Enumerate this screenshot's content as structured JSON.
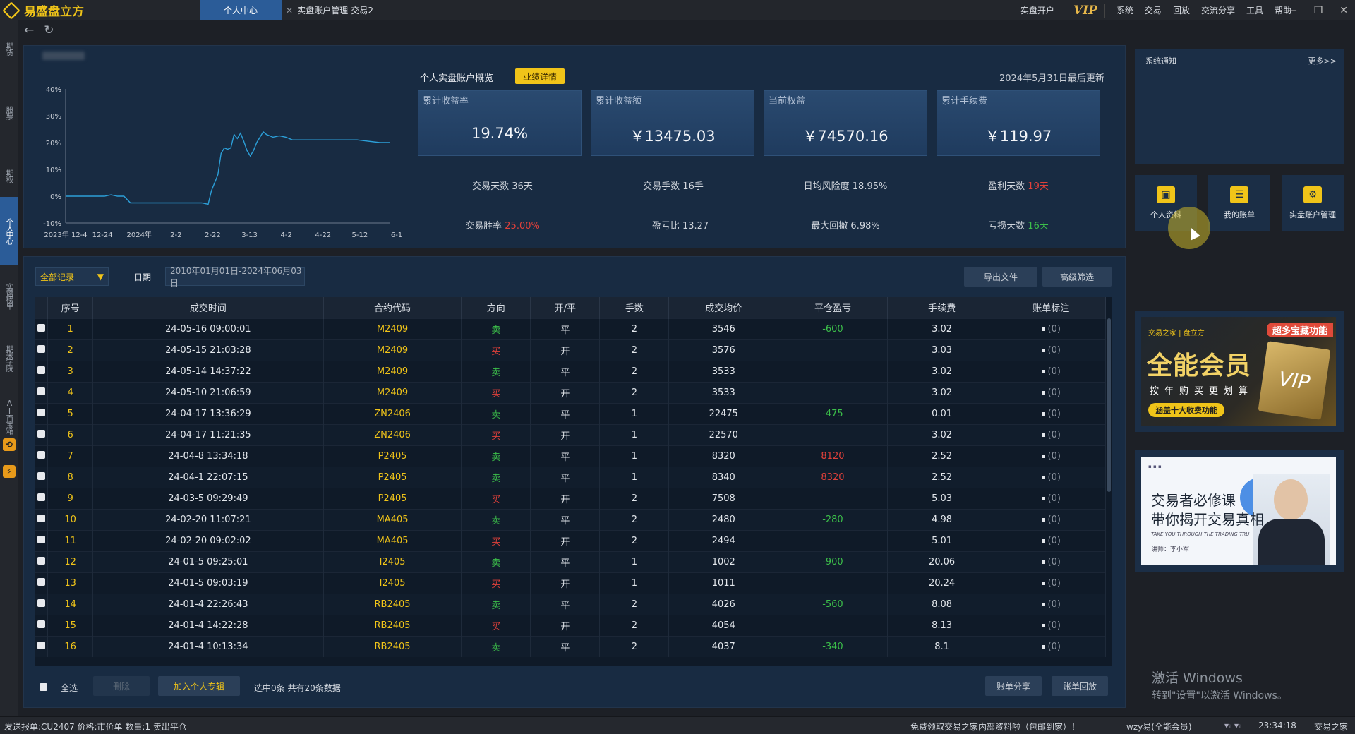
{
  "app": {
    "name": "易盛盘立方"
  },
  "tabs": [
    {
      "label": "个人中心",
      "active": true
    },
    {
      "label": "实盘账户管理-交易2",
      "active": false
    }
  ],
  "menu": {
    "open_account": "实盘开户",
    "vip": "VIP",
    "items": [
      "系统",
      "交易",
      "回放",
      "交流分享",
      "工具",
      "帮助"
    ]
  },
  "sidebar": {
    "items": [
      "期货",
      "股票",
      "期权",
      "个人中心",
      "实盘榜单",
      "期米学院",
      "AI百宝箱"
    ]
  },
  "overview": {
    "title": "个人实盘账户概览",
    "perf_button": "业绩详情",
    "updated": "2024年5月31日最后更新",
    "cards": [
      {
        "label": "累计收益率",
        "value": "19.74%"
      },
      {
        "label": "累计收益额",
        "value": "￥13475.03"
      },
      {
        "label": "当前权益",
        "value": "￥74570.16"
      },
      {
        "label": "累计手续费",
        "value": "￥119.97"
      }
    ],
    "stats_row1": [
      {
        "label": "交易天数",
        "value": "36天",
        "color": "normal"
      },
      {
        "label": "交易手数",
        "value": "16手",
        "color": "normal"
      },
      {
        "label": "日均风险度",
        "value": "18.95%",
        "color": "normal"
      },
      {
        "label": "盈利天数",
        "value": "19天",
        "color": "red"
      }
    ],
    "stats_row2": [
      {
        "label": "交易胜率",
        "value": "25.00%",
        "color": "red"
      },
      {
        "label": "盈亏比",
        "value": "13.27",
        "color": "normal"
      },
      {
        "label": "最大回撤",
        "value": "6.98%",
        "color": "normal"
      },
      {
        "label": "亏损天数",
        "value": "16天",
        "color": "green"
      }
    ]
  },
  "chart_data": {
    "type": "line",
    "title": "",
    "xlabel": "",
    "ylabel": "",
    "ylim": [
      -10,
      40
    ],
    "yticks": [
      "40%",
      "30%",
      "20%",
      "10%",
      "0%",
      "-10%"
    ],
    "xticks": [
      "2023年 12-4",
      "12-24",
      "2024年",
      "2-2",
      "2-22",
      "3-13",
      "4-2",
      "4-22",
      "5-12",
      "6-1"
    ],
    "series": [
      {
        "color": "#2c9fd8",
        "x": [
          0,
          12,
          14,
          16,
          18,
          20,
          24,
          42,
          44,
          45,
          46,
          47,
          48,
          49,
          50,
          51,
          52,
          53,
          54,
          55,
          56,
          57,
          58,
          59,
          60,
          61,
          62,
          64,
          66,
          68,
          70,
          72,
          75,
          80,
          90,
          97,
          100
        ],
        "y": [
          0,
          0,
          0.5,
          0,
          0,
          -2.5,
          -2.5,
          -2.5,
          -3,
          2,
          5,
          8,
          16,
          18,
          17.5,
          18,
          23,
          21.5,
          23.5,
          20.5,
          17,
          15,
          17,
          20,
          22,
          24,
          23,
          22,
          22.5,
          22,
          21,
          21,
          21,
          21,
          21,
          20,
          20
        ]
      }
    ]
  },
  "notice": {
    "title": "系统通知",
    "more": "更多>>"
  },
  "quick": [
    {
      "label": "个人资料",
      "icon": "id-card-icon"
    },
    {
      "label": "我的账单",
      "icon": "clipboard-icon"
    },
    {
      "label": "实盘账户管理",
      "icon": "user-gear-icon"
    }
  ],
  "ad1": {
    "brand": "交易之家 | 盘立方",
    "tag": "超多宝藏功能",
    "title": "全能会员",
    "sub": "按年购买更划算",
    "pill": "涵盖十大收费功能",
    "box": "VIP"
  },
  "ad2": {
    "line1": "交易者必修课",
    "line2": "带你揭开交易真相",
    "en": "TAKE YOU THROUGH THE TRADING TRU",
    "lecturer": "讲师：李小军"
  },
  "watermark": {
    "line1": "激活 Windows",
    "line2": "转到\"设置\"以激活 Windows。"
  },
  "records": {
    "filter": "全部记录",
    "date_label": "日期",
    "date_range": "2010年01月01日-2024年06月03日",
    "export": "导出文件",
    "advanced": "高级筛选",
    "columns": [
      "序号",
      "成交时间",
      "合约代码",
      "方向",
      "开/平",
      "手数",
      "成交均价",
      "平仓盈亏",
      "手续费",
      "账单标注"
    ],
    "rows": [
      [
        "1",
        "24-05-16 09:00:01",
        "M2409",
        "卖",
        "平",
        "2",
        "3546",
        "-600",
        "3.02",
        "(0)"
      ],
      [
        "2",
        "24-05-15 21:03:28",
        "M2409",
        "买",
        "开",
        "2",
        "3576",
        "",
        "3.03",
        "(0)"
      ],
      [
        "3",
        "24-05-14 14:37:22",
        "M2409",
        "卖",
        "平",
        "2",
        "3533",
        "",
        "3.02",
        "(0)"
      ],
      [
        "4",
        "24-05-10 21:06:59",
        "M2409",
        "买",
        "开",
        "2",
        "3533",
        "",
        "3.02",
        "(0)"
      ],
      [
        "5",
        "24-04-17 13:36:29",
        "ZN2406",
        "卖",
        "平",
        "1",
        "22475",
        "-475",
        "0.01",
        "(0)"
      ],
      [
        "6",
        "24-04-17 11:21:35",
        "ZN2406",
        "买",
        "开",
        "1",
        "22570",
        "",
        "3.02",
        "(0)"
      ],
      [
        "7",
        "24-04-8 13:34:18",
        "P2405",
        "卖",
        "平",
        "1",
        "8320",
        "8120",
        "2.52",
        "(0)"
      ],
      [
        "8",
        "24-04-1 22:07:15",
        "P2405",
        "卖",
        "平",
        "1",
        "8340",
        "8320",
        "2.52",
        "(0)"
      ],
      [
        "9",
        "24-03-5 09:29:49",
        "P2405",
        "买",
        "开",
        "2",
        "7508",
        "",
        "5.03",
        "(0)"
      ],
      [
        "10",
        "24-02-20 11:07:21",
        "MA405",
        "卖",
        "平",
        "2",
        "2480",
        "-280",
        "4.98",
        "(0)"
      ],
      [
        "11",
        "24-02-20 09:02:02",
        "MA405",
        "买",
        "开",
        "2",
        "2494",
        "",
        "5.01",
        "(0)"
      ],
      [
        "12",
        "24-01-5 09:25:01",
        "I2405",
        "卖",
        "平",
        "1",
        "1002",
        "-900",
        "20.06",
        "(0)"
      ],
      [
        "13",
        "24-01-5 09:03:19",
        "I2405",
        "买",
        "开",
        "1",
        "1011",
        "",
        "20.24",
        "(0)"
      ],
      [
        "14",
        "24-01-4 22:26:43",
        "RB2405",
        "卖",
        "平",
        "2",
        "4026",
        "-560",
        "8.08",
        "(0)"
      ],
      [
        "15",
        "24-01-4 14:22:28",
        "RB2405",
        "买",
        "开",
        "2",
        "4054",
        "",
        "8.13",
        "(0)"
      ],
      [
        "16",
        "24-01-4 10:13:34",
        "RB2405",
        "卖",
        "平",
        "2",
        "4037",
        "-340",
        "8.1",
        "(0)"
      ]
    ],
    "select_all": "全选",
    "delete": "删除",
    "add_collection": "加入个人专辑",
    "selection_info": "选中0条 共有20条数据",
    "share": "账单分享",
    "replay": "账单回放"
  },
  "status": {
    "left": "发送报单:CU2407 价格:市价单 数量:1 卖出平仓",
    "promo": "免费领取交易之家内部资料啦（包邮到家）！",
    "user": "wzy易(全能会员)",
    "time": "23:34:18",
    "org": "交易之家"
  }
}
